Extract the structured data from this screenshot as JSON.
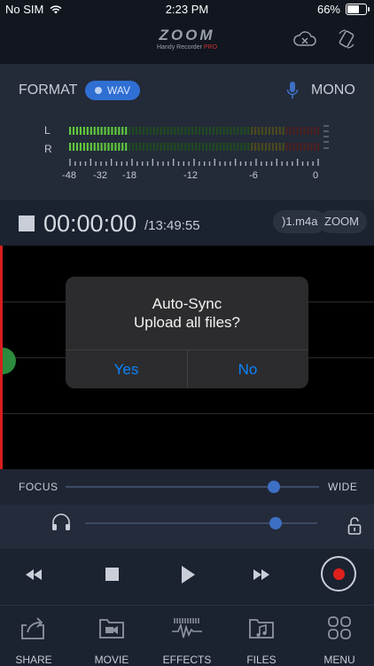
{
  "status": {
    "carrier": "No SIM",
    "time": "2:23 PM",
    "battery": "66%"
  },
  "header": {
    "brand": "ZOOM",
    "subtitle": "Handy Recorder",
    "subtitle_pro": "PRO"
  },
  "format": {
    "label": "FORMAT",
    "value": "WAV",
    "channel_label": "MONO"
  },
  "meter": {
    "left_label": "L",
    "right_label": "R",
    "scale": [
      "-48",
      "-32",
      "-18",
      "-12",
      "-6",
      "0"
    ],
    "level_left": 0.24,
    "level_right": 0.24
  },
  "timer": {
    "elapsed": "00:00:00",
    "remaining": "/13:49:55",
    "filename": ")1.m4a",
    "chip2": "ZOOM"
  },
  "dialog": {
    "title": "Auto-Sync",
    "message": "Upload all files?",
    "yes": "Yes",
    "no": "No"
  },
  "controls": {
    "focus_label": "FOCUS",
    "wide_label": "WIDE",
    "focus_value": 0.82,
    "volume_value": 0.82
  },
  "tabs": [
    {
      "label": "SHARE",
      "icon": "share-icon"
    },
    {
      "label": "MOVIE",
      "icon": "movie-icon"
    },
    {
      "label": "EFFECTS",
      "icon": "effects-icon"
    },
    {
      "label": "FILES",
      "icon": "files-icon"
    },
    {
      "label": "MENU",
      "icon": "menu-grid-icon"
    }
  ],
  "colors": {
    "accent": "#2f6fd3",
    "record": "#e0201c",
    "dialog_button": "#0a84ff",
    "playhead": "#d81e1e"
  }
}
